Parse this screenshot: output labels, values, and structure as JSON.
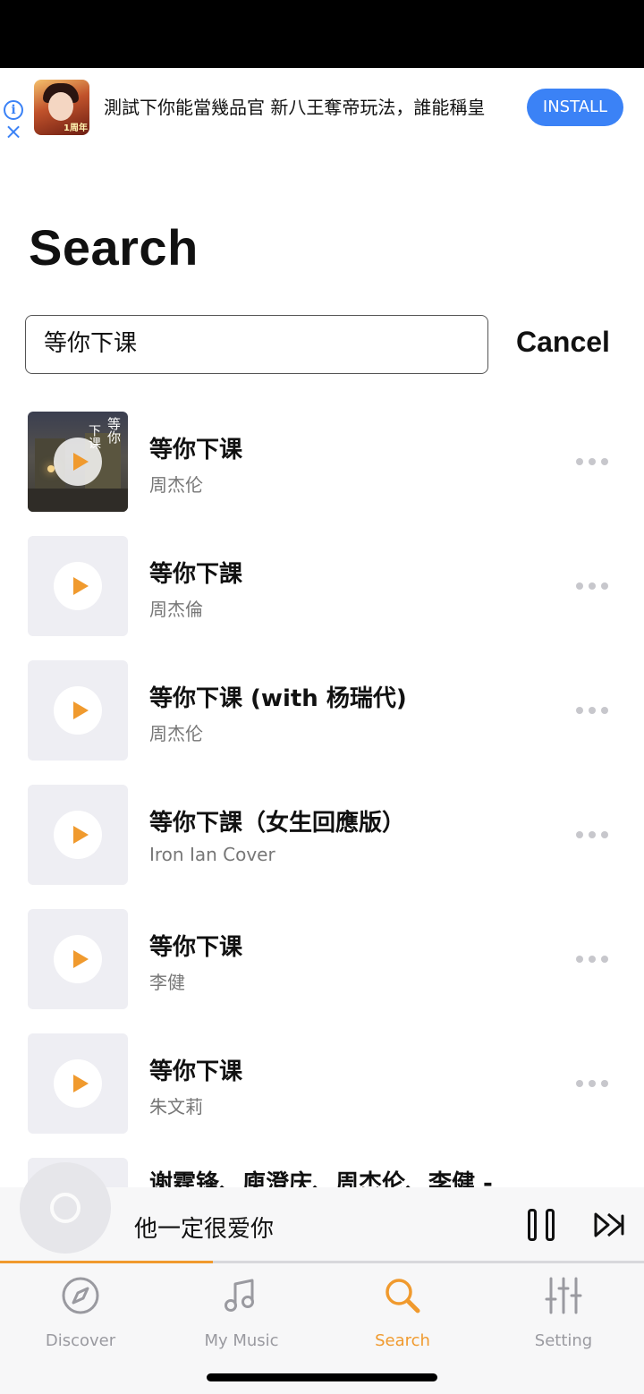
{
  "ad": {
    "text": "測試下你能當幾品官 新八王奪帝玩法，誰能稱皇",
    "install_label": "INSTALL",
    "info_icon": "info-icon",
    "close_icon": "close-icon",
    "thumb_badge": "1周年"
  },
  "page": {
    "title": "Search"
  },
  "search": {
    "value": "等你下课",
    "cancel_label": "Cancel"
  },
  "cover_art": {
    "text_main": "等你",
    "text_side": "下课"
  },
  "results": [
    {
      "title": "等你下课",
      "artist": "周杰伦",
      "has_artwork": true
    },
    {
      "title": "等你下課",
      "artist": "周杰倫",
      "has_artwork": false
    },
    {
      "title": "等你下课 (with 杨瑞代)",
      "artist": "周杰伦",
      "has_artwork": false
    },
    {
      "title": "等你下課（女生回應版）",
      "artist": "Iron Ian Cover",
      "has_artwork": false
    },
    {
      "title": "等你下课",
      "artist": "李健",
      "has_artwork": false
    },
    {
      "title": "等你下课",
      "artist": "朱文莉",
      "has_artwork": false
    },
    {
      "title": "谢霆锋、庾澄庆、周杰伦、李健 -",
      "artist": "",
      "has_artwork": false
    }
  ],
  "player": {
    "now_playing": "他一定很爱你",
    "progress_fraction": 0.33
  },
  "tabs": [
    {
      "label": "Discover",
      "icon": "compass-icon",
      "active": false
    },
    {
      "label": "My Music",
      "icon": "music-note-icon",
      "active": false
    },
    {
      "label": "Search",
      "icon": "search-icon",
      "active": true
    },
    {
      "label": "Setting",
      "icon": "sliders-icon",
      "active": false
    }
  ],
  "colors": {
    "accent": "#f09a2e",
    "install_blue": "#3b82f6",
    "tab_inactive": "#9a9aa0"
  }
}
